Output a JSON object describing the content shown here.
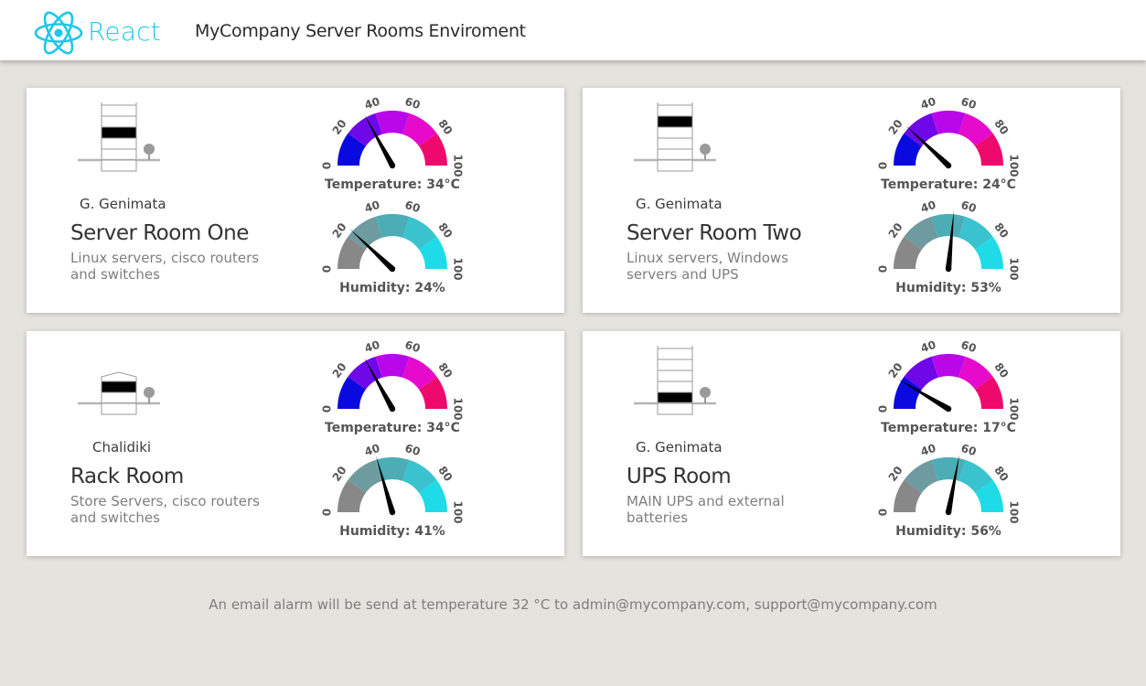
{
  "header": {
    "logo_icon": "react-atom-icon",
    "logo_text": "React",
    "title": "MyCompany Server Rooms Enviroment",
    "accent_color": "#1fc7e8"
  },
  "gauge_ticks": [
    "0",
    "20",
    "40",
    "60",
    "80",
    "100"
  ],
  "rooms": [
    {
      "location": "G. Genimata",
      "name": "Server Room One",
      "description": "Linux servers, cisco routers and switches",
      "floors_total": 5,
      "floor_highlighted": 3,
      "temperature": {
        "label": "Temperature: 34°C",
        "value": 34
      },
      "humidity": {
        "label": "Humidity: 24%",
        "value": 24
      }
    },
    {
      "location": "G. Genimata",
      "name": "Server Room Two",
      "description": "Linux servers, Windows servers and UPS",
      "floors_total": 5,
      "floor_highlighted": 4,
      "temperature": {
        "label": "Temperature: 24°C",
        "value": 24
      },
      "humidity": {
        "label": "Humidity: 53%",
        "value": 53
      }
    },
    {
      "location": "Chalidiki",
      "name": "Rack Room",
      "description": "Store Servers, cisco routers and switches",
      "floors_total": 2,
      "floor_highlighted": 2,
      "temperature": {
        "label": "Temperature: 34°C",
        "value": 34
      },
      "humidity": {
        "label": "Humidity: 41%",
        "value": 41
      }
    },
    {
      "location": "G. Genimata",
      "name": "UPS Room",
      "description": "MAIN UPS and external batteries",
      "floors_total": 7,
      "floor_highlighted": 1,
      "temperature": {
        "label": "Temperature: 17°C",
        "value": 17
      },
      "humidity": {
        "label": "Humidity: 56%",
        "value": 56
      }
    }
  ],
  "temperature_colors": [
    "#0a09e0",
    "#6e08e8",
    "#b808ea",
    "#e60acc",
    "#ee0a6c"
  ],
  "humidity_colors": [
    "#888888",
    "#6e9ba0",
    "#4cadb6",
    "#3ac3cf",
    "#1fdbe8"
  ],
  "footer": {
    "note": "An email alarm will be send at temperature 32 °C to admin@mycompany.com, support@mycompany.com"
  }
}
